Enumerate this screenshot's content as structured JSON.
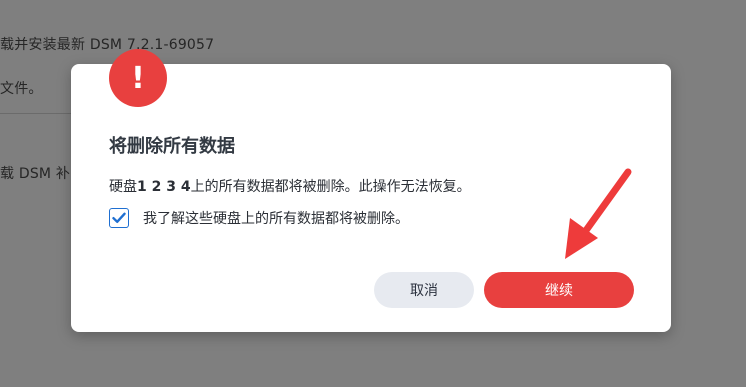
{
  "background": {
    "line_1": "载并安装最新 DSM 7.2.1-69057",
    "line_2": "文件。",
    "line_3": "载 DSM 补"
  },
  "dialog": {
    "icon": "exclamation-icon",
    "icon_glyph": "!",
    "title": "将删除所有数据",
    "message_prefix": "硬盘",
    "disk_ids": "1 2 3 4",
    "message_suffix": "上的所有数据都将被删除。此操作无法恢复。",
    "confirm_checkbox": {
      "checked": true,
      "label": "我了解这些硬盘上的所有数据都将被删除。"
    },
    "cancel_label": "取消",
    "continue_label": "继续"
  },
  "colors": {
    "accent_red": "#e8403f",
    "checkbox_blue": "#1f6fd1",
    "cancel_bg": "#e7eaf0",
    "overlay": "#7f7f7f"
  }
}
